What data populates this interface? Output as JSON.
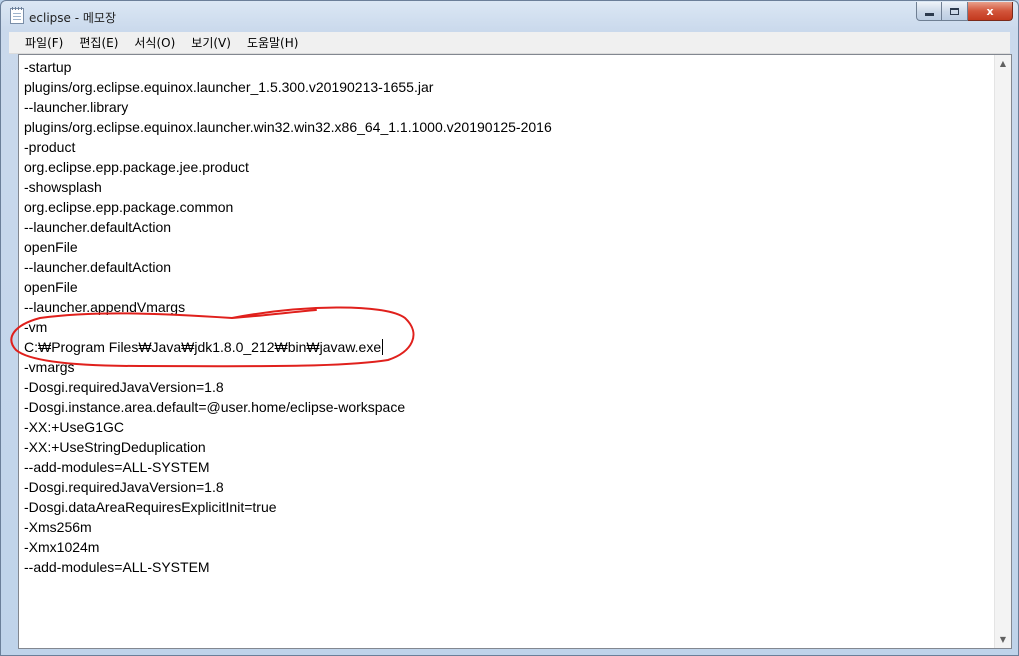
{
  "window": {
    "title": "eclipse - 메모장",
    "controls": {
      "minimize": "minimize",
      "maximize": "maximize",
      "close": "x"
    }
  },
  "menu": [
    "파일(F)",
    "편집(E)",
    "서식(O)",
    "보기(V)",
    "도움말(H)"
  ],
  "document": {
    "lines": [
      "-startup",
      "plugins/org.eclipse.equinox.launcher_1.5.300.v20190213-1655.jar",
      "--launcher.library",
      "plugins/org.eclipse.equinox.launcher.win32.win32.x86_64_1.1.1000.v20190125-2016",
      "-product",
      "org.eclipse.epp.package.jee.product",
      "-showsplash",
      "org.eclipse.epp.package.common",
      "--launcher.defaultAction",
      "openFile",
      "--launcher.defaultAction",
      "openFile",
      "--launcher.appendVmargs",
      "-vm",
      "C:₩Program Files₩Java₩jdk1.8.0_212₩bin₩javaw.exe",
      "-vmargs",
      "-Dosgi.requiredJavaVersion=1.8",
      "-Dosgi.instance.area.default=@user.home/eclipse-workspace",
      "-XX:+UseG1GC",
      "-XX:+UseStringDeduplication",
      "--add-modules=ALL-SYSTEM",
      "-Dosgi.requiredJavaVersion=1.8",
      "-Dosgi.dataAreaRequiresExplicitInit=true",
      "-Xms256m",
      "-Xmx1024m",
      "--add-modules=ALL-SYSTEM"
    ],
    "caret_line_index": 14
  },
  "annotation": {
    "color": "#e0201c"
  },
  "scrollbar": {
    "up_icon": "arrow-up-icon",
    "down_icon": "arrow-down-icon"
  }
}
